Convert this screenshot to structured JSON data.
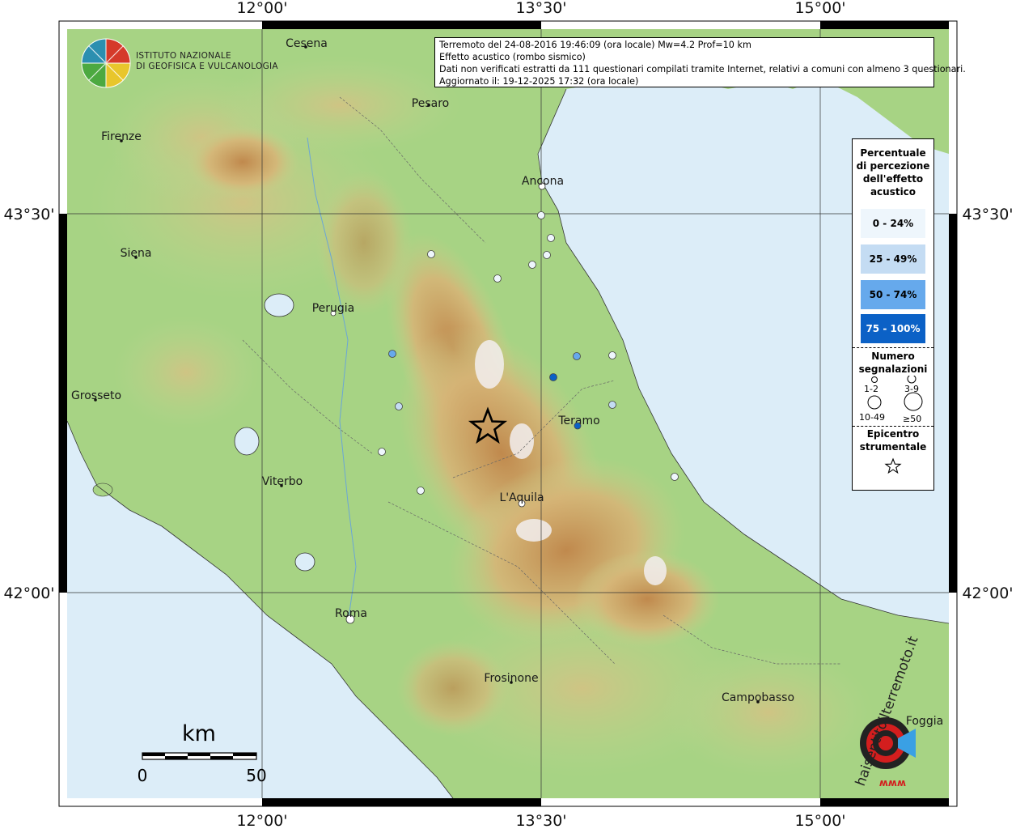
{
  "header": {
    "line1": "Terremoto del 24-08-2016 19:46:09 (ora locale) Mw=4.2 Prof=10 km",
    "line2": "Effetto acustico (rombo sismico)",
    "line3": "Dati non verificati estratti da 111 questionari compilati tramite Internet, relativi a comuni con almeno 3 questionari.",
    "line4": "Aggiornato il: 19-12-2025 17:32 (ora locale)"
  },
  "logo": {
    "line1": "ISTITUTO NAZIONALE",
    "line2": "DI GEOFISICA E VULCANOLOGIA"
  },
  "axes": {
    "lon_ticks": [
      "12°00'",
      "13°30'",
      "15°00'"
    ],
    "lat_ticks": [
      "43°30'",
      "42°00'"
    ]
  },
  "cities": [
    {
      "name": "Cesena"
    },
    {
      "name": "Pesaro"
    },
    {
      "name": "Firenze"
    },
    {
      "name": "Ancona"
    },
    {
      "name": "Siena"
    },
    {
      "name": "Perugia"
    },
    {
      "name": "Grosseto"
    },
    {
      "name": "Teramo"
    },
    {
      "name": "Viterbo"
    },
    {
      "name": "L'Aquila"
    },
    {
      "name": "Roma"
    },
    {
      "name": "Frosinone"
    },
    {
      "name": "Campobasso"
    },
    {
      "name": "Foggia"
    }
  ],
  "legend": {
    "title": "Percentuale di percezione dell'effetto acustico",
    "classes": [
      {
        "label": "0 - 24%",
        "color": "#eef6fc",
        "text_color": "#000000"
      },
      {
        "label": "25 - 49%",
        "color": "#c4dcf3",
        "text_color": "#000000"
      },
      {
        "label": "50 - 74%",
        "color": "#66a9ec",
        "text_color": "#000000"
      },
      {
        "label": "75 - 100%",
        "color": "#0b61c6",
        "text_color": "#ffffff"
      }
    ],
    "count_title": "Numero segnalazioni",
    "count_classes": [
      "1-2",
      "3-9",
      "10-49",
      "≥50"
    ],
    "epicenter_title": "Epicentro strumentale"
  },
  "scale_bar": {
    "unit": "km",
    "start": "0",
    "end": "50"
  },
  "watermark": {
    "text": "haisentitoilterremoto.it",
    "short": "www"
  },
  "colors": {
    "sea": "#dcedf8",
    "land_low": "#9fcf7e",
    "land_mid": "#d7c98a",
    "land_high": "#b07c44",
    "peak": "#f2eef0"
  }
}
